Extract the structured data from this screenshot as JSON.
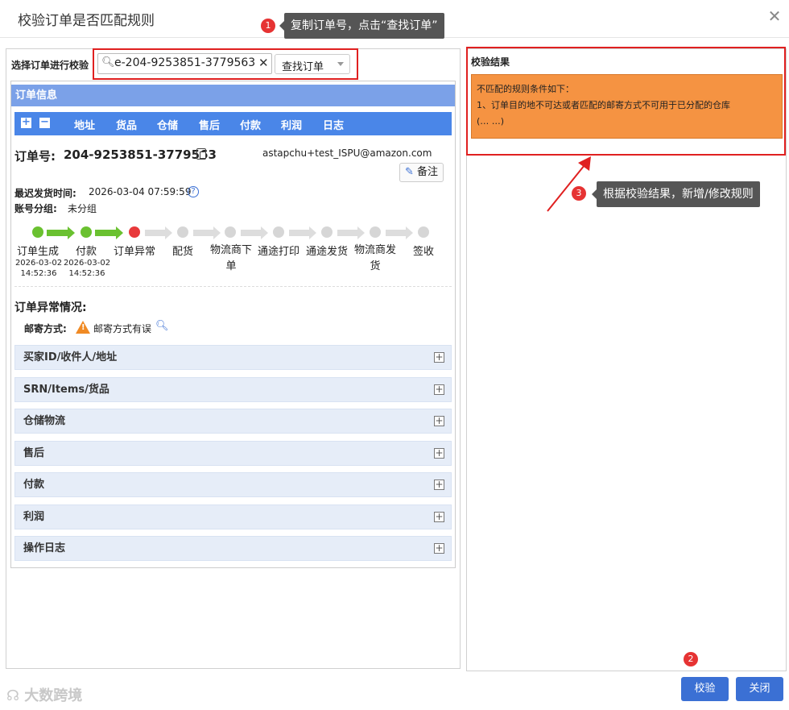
{
  "dialog": {
    "title": "校验订单是否匹配规则"
  },
  "tips": [
    {
      "num": "1",
      "text": "复制订单号，点击“查找订单”"
    },
    {
      "num": "2"
    },
    {
      "num": "3",
      "text": "根据校验结果，新增/修改规则"
    }
  ],
  "left": {
    "select_label": "选择订单进行校验",
    "search_value": "e-204-9253851-3779563",
    "dropdown_label": "查找订单",
    "section_title": "订单信息",
    "tabs": [
      "地址",
      "货品",
      "仓储",
      "售后",
      "付款",
      "利润",
      "日志"
    ],
    "order_no_label": "订单号:",
    "order_no": "204-9253851-3779563",
    "account": "astapchu+test_ISPU@amazon.com",
    "note_button": "备注",
    "latest_ship_label": "最迟发货时间:",
    "latest_ship_value": "2026-03-04 07:59:59",
    "account_group_label": "账号分组:",
    "account_group_value": "未分组",
    "steps": [
      {
        "label": "订单生成",
        "time1": "2026-03-02",
        "time2": "14:52:36"
      },
      {
        "label": "付款",
        "time1": "2026-03-02",
        "time2": "14:52:36"
      },
      {
        "label": "订单异常"
      },
      {
        "label": "配货"
      },
      {
        "label": "物流商下单"
      },
      {
        "label": "通途打印"
      },
      {
        "label": "通途发货"
      },
      {
        "label": "物流商发货"
      },
      {
        "label": "签收"
      }
    ],
    "exception_title": "订单异常情况:",
    "mail_label": "邮寄方式:",
    "mail_value": "邮寄方式有误",
    "accordions": [
      "买家ID/收件人/地址",
      "SRN/Items/货品",
      "仓储物流",
      "售后",
      "付款",
      "利润",
      "操作日志"
    ]
  },
  "right": {
    "result_title": "校验结果",
    "result_line1": "不匹配的规则条件如下：",
    "result_line2": "1、订单目的地不可达或者匹配的邮寄方式不可用于已分配的仓库",
    "result_line3": "(… …)"
  },
  "footer": {
    "verify": "校验",
    "close": "关闭",
    "watermark": "大数跨境"
  },
  "colors": {
    "tab_blue": "#4a86e8",
    "head_blue": "#7ba1e8",
    "result_orange": "#f59342",
    "alert_red": "#e02020"
  }
}
